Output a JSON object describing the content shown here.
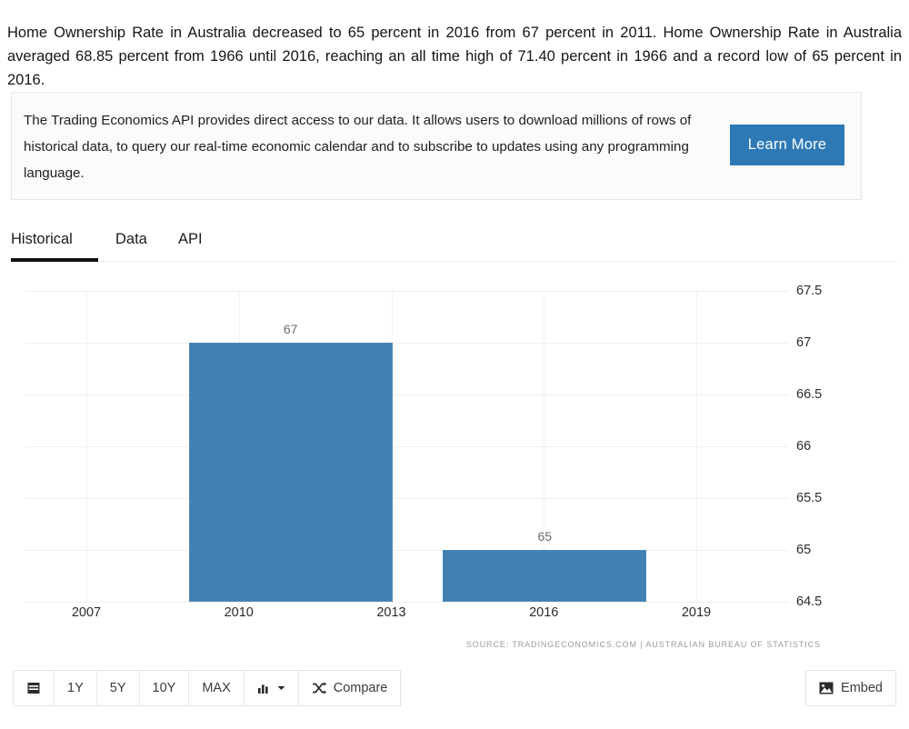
{
  "intro": {
    "text": "Home Ownership Rate in Australia decreased to 65 percent in 2016 from 67 percent in 2011. Home Ownership Rate in Australia averaged 68.85 percent from 1966 until 2016, reaching an all time high of 71.40 percent in 1966 and a record low of 65 percent in 2016."
  },
  "promo": {
    "text": "The Trading Economics API provides direct access to our data. It allows users to download millions of rows of historical data, to query our real-time economic calendar and to subscribe to updates using any programming language.",
    "button_label": "Learn More",
    "button_color": "#2d79b6"
  },
  "tabs": [
    {
      "label": "Historical",
      "active": true
    },
    {
      "label": "Data",
      "active": false
    },
    {
      "label": "API",
      "active": false
    }
  ],
  "toolbar": {
    "range_buttons": [
      "1Y",
      "5Y",
      "10Y",
      "MAX"
    ],
    "calendar_icon": "calendar-icon",
    "chart_type_icon": "bar-chart-icon",
    "chart_type_caret": "caret-down-icon",
    "compare_label": "Compare",
    "compare_icon": "shuffle-icon",
    "embed_label": "Embed",
    "embed_icon": "image-icon"
  },
  "chart_data": {
    "type": "bar",
    "title": "",
    "xlabel": "",
    "ylabel": "",
    "categories": [
      "2011",
      "2016"
    ],
    "values": [
      67,
      65
    ],
    "bar_labels": [
      "67",
      "65"
    ],
    "bar_color": "#4180b0",
    "ylim": [
      64.5,
      67.5
    ],
    "yticks": [
      "67.5",
      "67",
      "66.5",
      "66",
      "65.5",
      "65",
      "64.5"
    ],
    "ytick_values": [
      67.5,
      67,
      66.5,
      66,
      65.5,
      65,
      64.5
    ],
    "xticks": [
      "2007",
      "2010",
      "2013",
      "2016",
      "2019"
    ],
    "xtick_values": [
      2007,
      2010,
      2013,
      2016,
      2019
    ],
    "grid": true,
    "legend": false,
    "source": "SOURCE: TRADINGECONOMICS.COM | AUSTRALIAN BUREAU OF STATISTICS"
  }
}
